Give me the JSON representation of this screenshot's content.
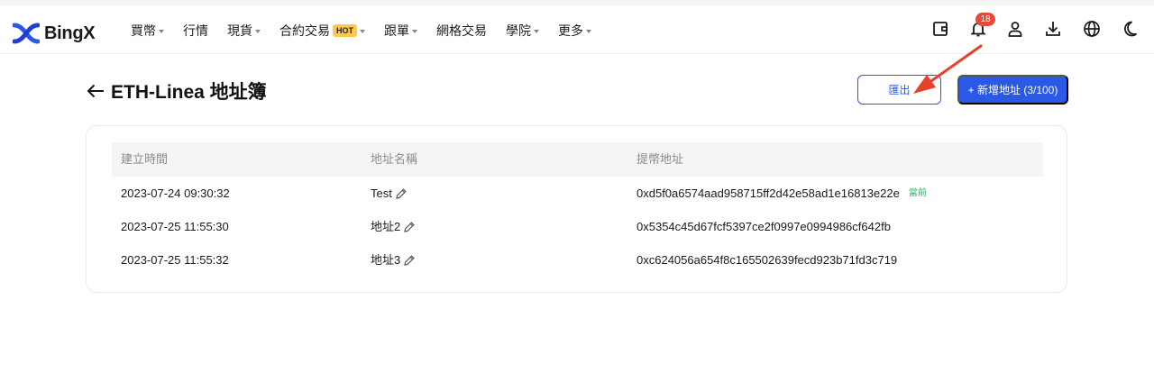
{
  "header": {
    "logo_text": "BingX",
    "nav": [
      {
        "label": "買幣",
        "has_dropdown": true
      },
      {
        "label": "行情",
        "has_dropdown": false
      },
      {
        "label": "現貨",
        "has_dropdown": true
      },
      {
        "label": "合約交易",
        "badge": "HOT",
        "has_dropdown": true
      },
      {
        "label": "跟單",
        "has_dropdown": true
      },
      {
        "label": "網格交易",
        "has_dropdown": false
      },
      {
        "label": "學院",
        "has_dropdown": true
      },
      {
        "label": "更多",
        "has_dropdown": true
      }
    ],
    "notification_count": "18",
    "tools": [
      "wallet-icon",
      "bell-icon",
      "user-icon",
      "download-icon",
      "globe-icon",
      "moon-icon"
    ]
  },
  "page": {
    "title": "ETH-Linea 地址簿",
    "export_label": "匯出",
    "add_label": "+ 新增地址 (3/100)"
  },
  "table": {
    "columns": [
      "建立時間",
      "地址名稱",
      "提幣地址"
    ],
    "rows": [
      {
        "created": "2023-07-24 09:30:32",
        "name": "Test",
        "address": "0xd5f0a6574aad958715ff2d42e58ad1e16813e22e",
        "tag": "當前"
      },
      {
        "created": "2023-07-25 11:55:30",
        "name": "地址2",
        "address": "0x5354c45d67fcf5397ce2f0997e0994986cf642fb",
        "tag": ""
      },
      {
        "created": "2023-07-25 11:55:32",
        "name": "地址3",
        "address": "0xc624056a654f8c165502639fecd923b71fd3c719",
        "tag": ""
      }
    ]
  },
  "colors": {
    "primary": "#2a59e6",
    "badge": "#e8473c",
    "hot": "#ffc94a",
    "current_tag": "#27b56a",
    "annotation_arrow": "#e8402a"
  }
}
